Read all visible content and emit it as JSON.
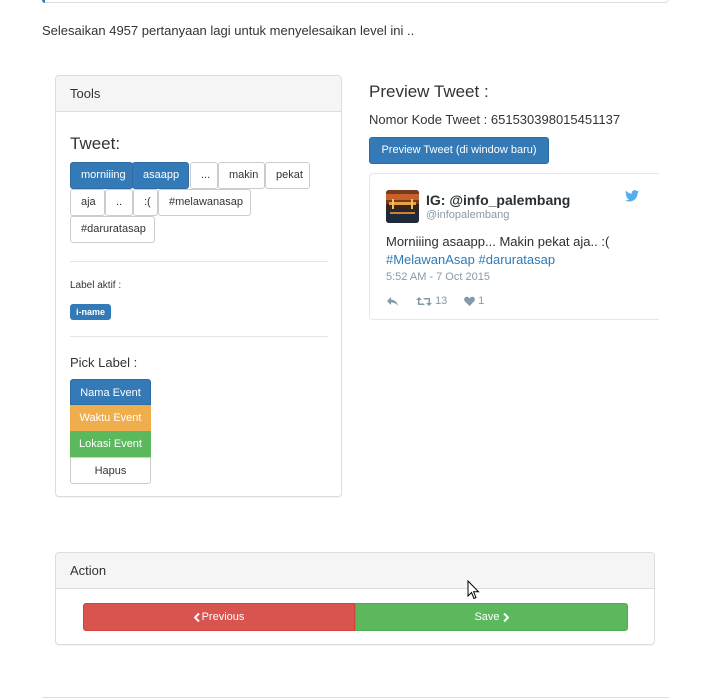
{
  "progress_text": "Selesaikan 4957 pertanyaan lagi untuk menyelesaikan level ini ..",
  "tools": {
    "heading": "Tools",
    "tweet_title": "Tweet:",
    "tokens": [
      {
        "text": "morniiing",
        "selected": true
      },
      {
        "text": "asaapp",
        "selected": true
      },
      {
        "text": "...",
        "selected": false
      },
      {
        "text": "makin",
        "selected": false
      },
      {
        "text": "pekat",
        "selected": false
      },
      {
        "text": "aja",
        "selected": false
      },
      {
        "text": "..",
        "selected": false
      },
      {
        "text": ":(",
        "selected": false
      },
      {
        "text": "#melawanasap",
        "selected": false
      },
      {
        "text": "#daruratasap",
        "selected": false
      }
    ],
    "active_label_title": "Label aktif :",
    "active_label": "i-name",
    "pick_title": "Pick Label :",
    "pick_labels": [
      "Nama Event",
      "Waktu Event",
      "Lokasi Event",
      "Hapus"
    ]
  },
  "preview": {
    "title": "Preview Tweet :",
    "nomor": "Nomor Kode Tweet : 651530398015451137",
    "button": "Preview Tweet (di window baru)",
    "tweet": {
      "name": "IG: @info_palembang",
      "handle": "@infopalembang",
      "text": "Morniiing asaapp... Makin pekat aja.. :(",
      "hashtags": "#MelawanAsap #daruratasap",
      "time": "5:52 AM - 7 Oct 2015",
      "retweets": "13",
      "likes": "1"
    }
  },
  "action": {
    "heading": "Action",
    "previous": "Previous",
    "save": "Save"
  },
  "colors": {
    "primary": "#337ab7",
    "warning": "#f0ad4e",
    "success": "#5cb85c",
    "danger": "#d9534f",
    "twitter": "#55acee"
  }
}
